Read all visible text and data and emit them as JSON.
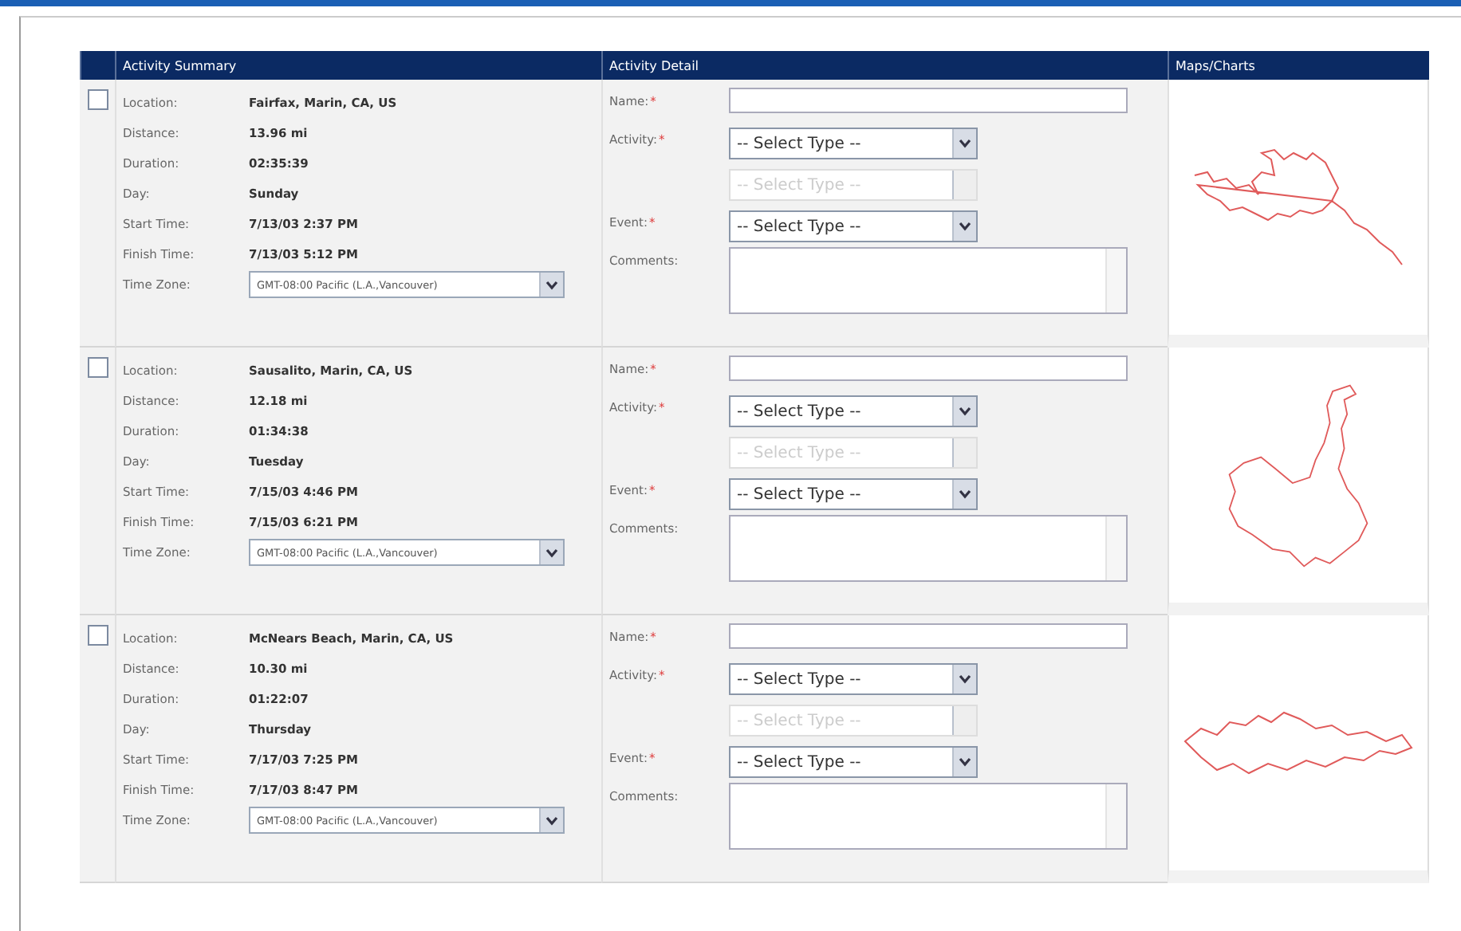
{
  "table": {
    "columns": [
      "Activity Summary",
      "Activity Detail",
      "Maps/Charts"
    ]
  },
  "rows": [
    {
      "checked": false,
      "summary": [
        {
          "label": "Location:",
          "value": "Fairfax, Marin, CA, US"
        },
        {
          "label": "Distance:",
          "value": "13.96 mi"
        },
        {
          "label": "Duration:",
          "value": "02:35:39"
        },
        {
          "label": "Day:",
          "value": "Sunday"
        },
        {
          "label": "Start Time:",
          "value": "7/13/03 2:37 PM"
        },
        {
          "label": "Finish Time:",
          "value": "7/13/03 5:12 PM"
        }
      ],
      "time_zone": {
        "label": "Time Zone:",
        "value": "GMT-08:00 Pacific (L.A.,Vancouver)"
      },
      "detail": {
        "name": {
          "label": "Name:",
          "mark": "*"
        },
        "activity": {
          "label": "Activity:",
          "mark": "*",
          "value": "-- Select Type --"
        },
        "sub_activity": {
          "value": "-- Select Type --",
          "disabled": true
        },
        "event": {
          "label": "Event:",
          "mark": "*",
          "value": "-- Select Type --"
        },
        "comments": {
          "label": "Comments:"
        }
      }
    },
    {
      "checked": false,
      "summary": [
        {
          "label": "Location:",
          "value": "Sausalito, Marin, CA, US"
        },
        {
          "label": "Distance:",
          "value": "12.18 mi"
        },
        {
          "label": "Duration:",
          "value": "01:34:38"
        },
        {
          "label": "Day:",
          "value": "Tuesday"
        },
        {
          "label": "Start Time:",
          "value": "7/15/03 4:46 PM"
        },
        {
          "label": "Finish Time:",
          "value": "7/15/03 6:21 PM"
        }
      ],
      "time_zone": {
        "label": "Time Zone:",
        "value": "GMT-08:00 Pacific (L.A.,Vancouver)"
      },
      "detail": {
        "name": {
          "label": "Name:",
          "mark": "*"
        },
        "activity": {
          "label": "Activity:",
          "mark": "*",
          "value": "-- Select Type --"
        },
        "sub_activity": {
          "value": "-- Select Type --",
          "disabled": true
        },
        "event": {
          "label": "Event:",
          "mark": "*",
          "value": "-- Select Type --"
        },
        "comments": {
          "label": "Comments:"
        }
      }
    },
    {
      "checked": false,
      "summary": [
        {
          "label": "Location:",
          "value": "McNears Beach, Marin, CA, US"
        },
        {
          "label": "Distance:",
          "value": "10.30 mi"
        },
        {
          "label": "Duration:",
          "value": "01:22:07"
        },
        {
          "label": "Day:",
          "value": "Thursday"
        },
        {
          "label": "Start Time:",
          "value": "7/17/03 7:25 PM"
        },
        {
          "label": "Finish Time:",
          "value": "7/17/03 8:47 PM"
        }
      ],
      "time_zone": {
        "label": "Time Zone:",
        "value": "GMT-08:00 Pacific (L.A.,Vancouver)"
      },
      "detail": {
        "name": {
          "label": "Name:",
          "mark": "*"
        },
        "activity": {
          "label": "Activity:",
          "mark": "*",
          "value": "-- Select Type --"
        },
        "sub_activity": {
          "value": "-- Select Type --",
          "disabled": true
        },
        "event": {
          "label": "Event:",
          "mark": "*",
          "value": "-- Select Type --"
        },
        "comments": {
          "label": "Comments:"
        }
      }
    }
  ]
}
